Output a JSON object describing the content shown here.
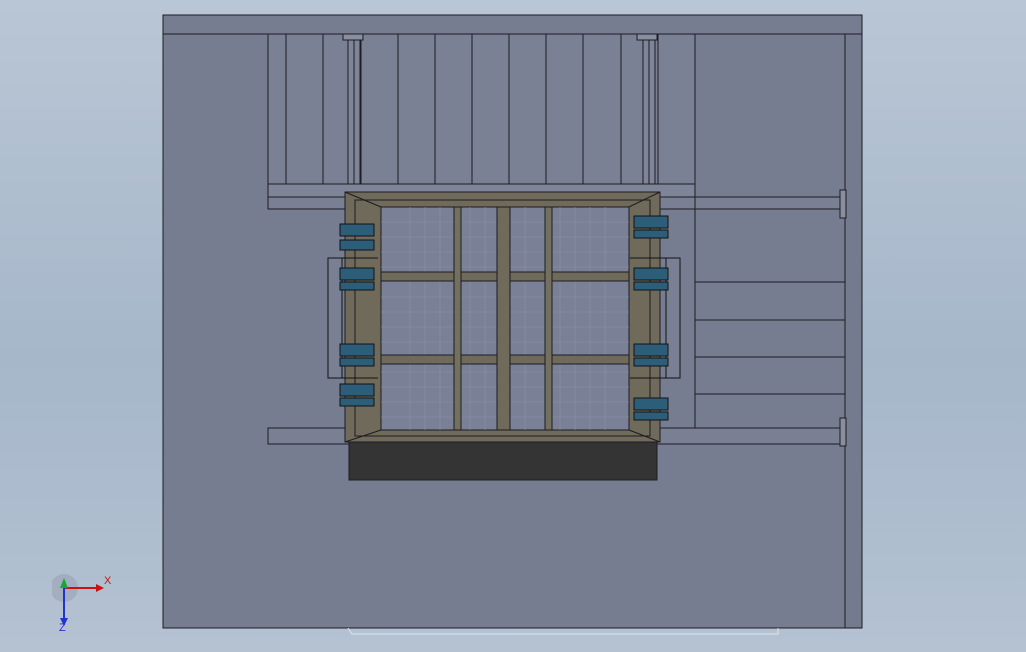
{
  "viewport": {
    "background_top": "#b9c6d5",
    "background_bottom": "#a6b7ca"
  },
  "model": {
    "panel_color": "#777d90",
    "line_color": "#1c1c22",
    "frame_color": "#6f6a5a",
    "base_color": "#343434",
    "mesh_color": "#7a8095",
    "bearing_color": "#2c5e7a"
  },
  "triad": {
    "x_label": "X",
    "z_label": "Z",
    "x_color": "#cc1111",
    "y_color": "#11aa33",
    "z_color": "#2233cc"
  }
}
